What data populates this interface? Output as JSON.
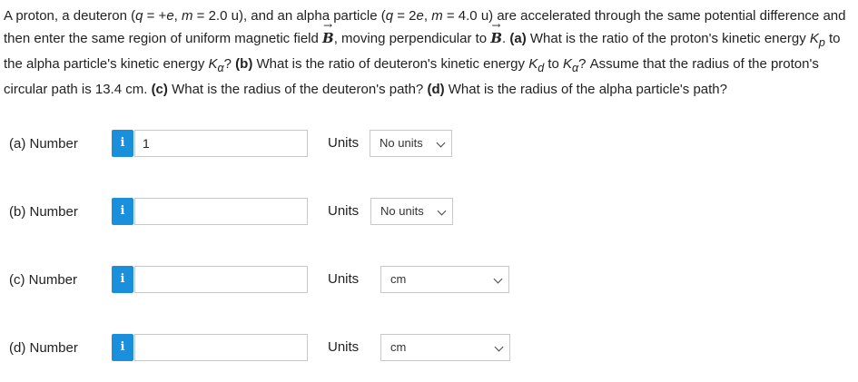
{
  "question": {
    "s1": "A proton, a deuteron (",
    "q": "q",
    "s2": " = +",
    "e1": "e",
    "s3": ", ",
    "m": "m",
    "s4": " = 2.0 u), and an alpha particle (",
    "s5": " = 2",
    "s6": " = 4.0 u) are accelerated through the same potential difference and then enter the same region of uniform magnetic field ",
    "B": "B",
    "s7": ", moving perpendicular to ",
    "s8": ".",
    "pa": " (a)",
    "s9": " What is the ratio of the proton's kinetic energy ",
    "K": "K",
    "sub_p": "p",
    "s10": " to the alpha particle's kinetic energy ",
    "sub_alpha": "α",
    "s11": "? ",
    "pb": "(b)",
    "s12": " What is the ratio of deuteron's kinetic energy ",
    "sub_d": "d",
    "s13": " to ",
    "s14": "? Assume that the radius of the proton's circular path is 13.4 cm. ",
    "pc": "(c)",
    "s15": " What is the radius of the deuteron's path? ",
    "pd": "(d)",
    "s16": " What is the radius of the alpha particle's path?"
  },
  "rows": [
    {
      "label": "(a)  Number",
      "info": "i",
      "value": "1",
      "units_label": "Units",
      "units": "No units"
    },
    {
      "label": "(b)  Number",
      "info": "i",
      "value": "",
      "units_label": "Units",
      "units": "No units"
    },
    {
      "label": "(c)  Number",
      "info": "i",
      "value": "",
      "units_label": "Units",
      "units": "cm"
    },
    {
      "label": "(d)  Number",
      "info": "i",
      "value": "",
      "units_label": "Units",
      "units": "cm"
    }
  ]
}
